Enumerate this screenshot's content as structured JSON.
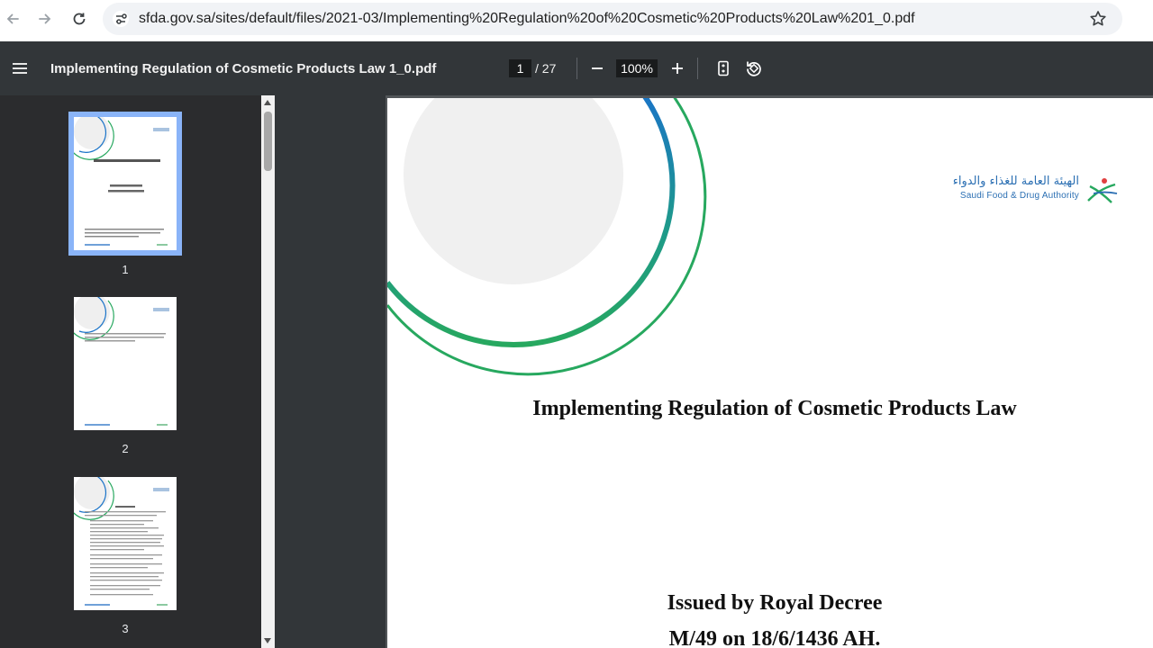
{
  "browser": {
    "url": "sfda.gov.sa/sites/default/files/2021-03/Implementing%20Regulation%20of%20Cosmetic%20Products%20Law%201_0.pdf"
  },
  "toolbar": {
    "title": "Implementing Regulation of Cosmetic Products Law 1_0.pdf",
    "page_current": "1",
    "page_total": "/ 27",
    "zoom": "100%"
  },
  "sidebar": {
    "thumbnails": [
      {
        "number": "1",
        "selected": true
      },
      {
        "number": "2",
        "selected": false
      },
      {
        "number": "3",
        "selected": false
      }
    ]
  },
  "document": {
    "title": "Implementing Regulation of Cosmetic Products Law",
    "decree_line": "Issued by Royal Decree",
    "date_line": "M/49 on 18/6/1436 AH.",
    "logo_arabic": "الهيئة العامة للغذاء والدواء",
    "logo_english": "Saudi Food & Drug Authority"
  },
  "colors": {
    "accent_blue": "#1a73c8",
    "accent_green": "#27a85f",
    "toolbar_bg": "#323639",
    "sidebar_bg": "#2b2c2e"
  }
}
